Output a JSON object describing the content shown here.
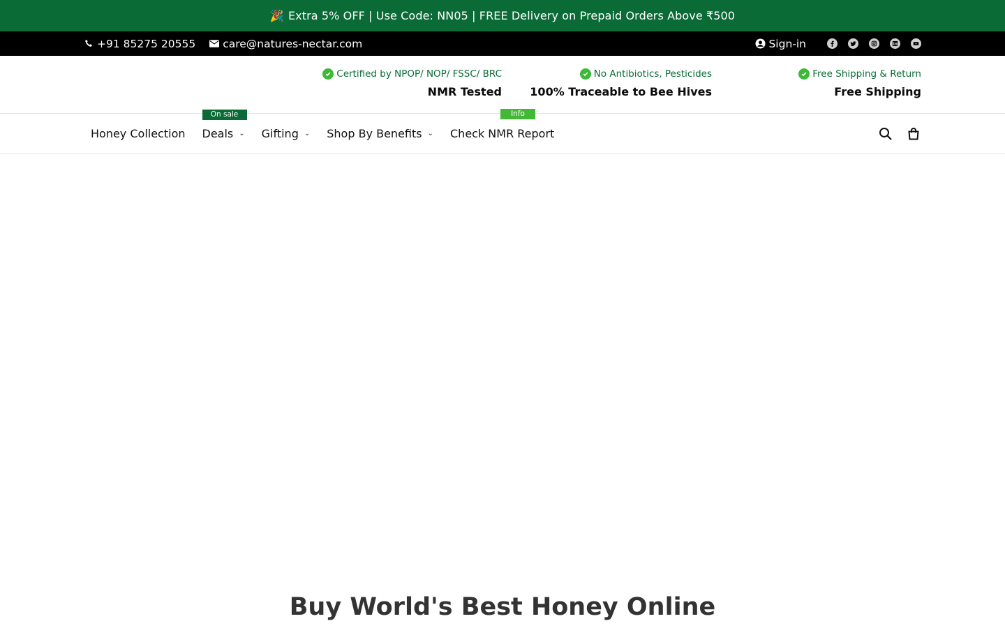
{
  "announcement": {
    "icon": "party-popper-icon",
    "text": "Extra 5% OFF | Use Code: NN05 | FREE Delivery on Prepaid Orders Above ₹500"
  },
  "topbar": {
    "phone": "+91 85275 20555",
    "email": "care@natures-nectar.com",
    "signin": "Sign-in",
    "social": [
      "facebook-icon",
      "twitter-icon",
      "instagram-icon",
      "linkedin-icon",
      "youtube-icon"
    ]
  },
  "badges": [
    {
      "line1": "Certified by NPOP/ NOP/ FSSC/ BRC",
      "line2": "NMR Tested"
    },
    {
      "line1": "No Antibiotics, Pesticides",
      "line2": "100% Traceable to Bee Hives"
    },
    {
      "line1": "Free Shipping & Return",
      "line2": "Free Shipping"
    }
  ],
  "nav": {
    "items": [
      {
        "label": "Honey Collection"
      },
      {
        "label": "Deals",
        "tag": "On sale"
      },
      {
        "label": "Gifting"
      },
      {
        "label": "Shop By Benefits"
      },
      {
        "label": "Check NMR Report",
        "tag": "Info"
      }
    ]
  },
  "main": {
    "heading": "Buy World's Best Honey Online"
  },
  "colors": {
    "brand_green": "#0a6b36",
    "accent_green": "#43b837",
    "topbar_bg": "#000000"
  }
}
